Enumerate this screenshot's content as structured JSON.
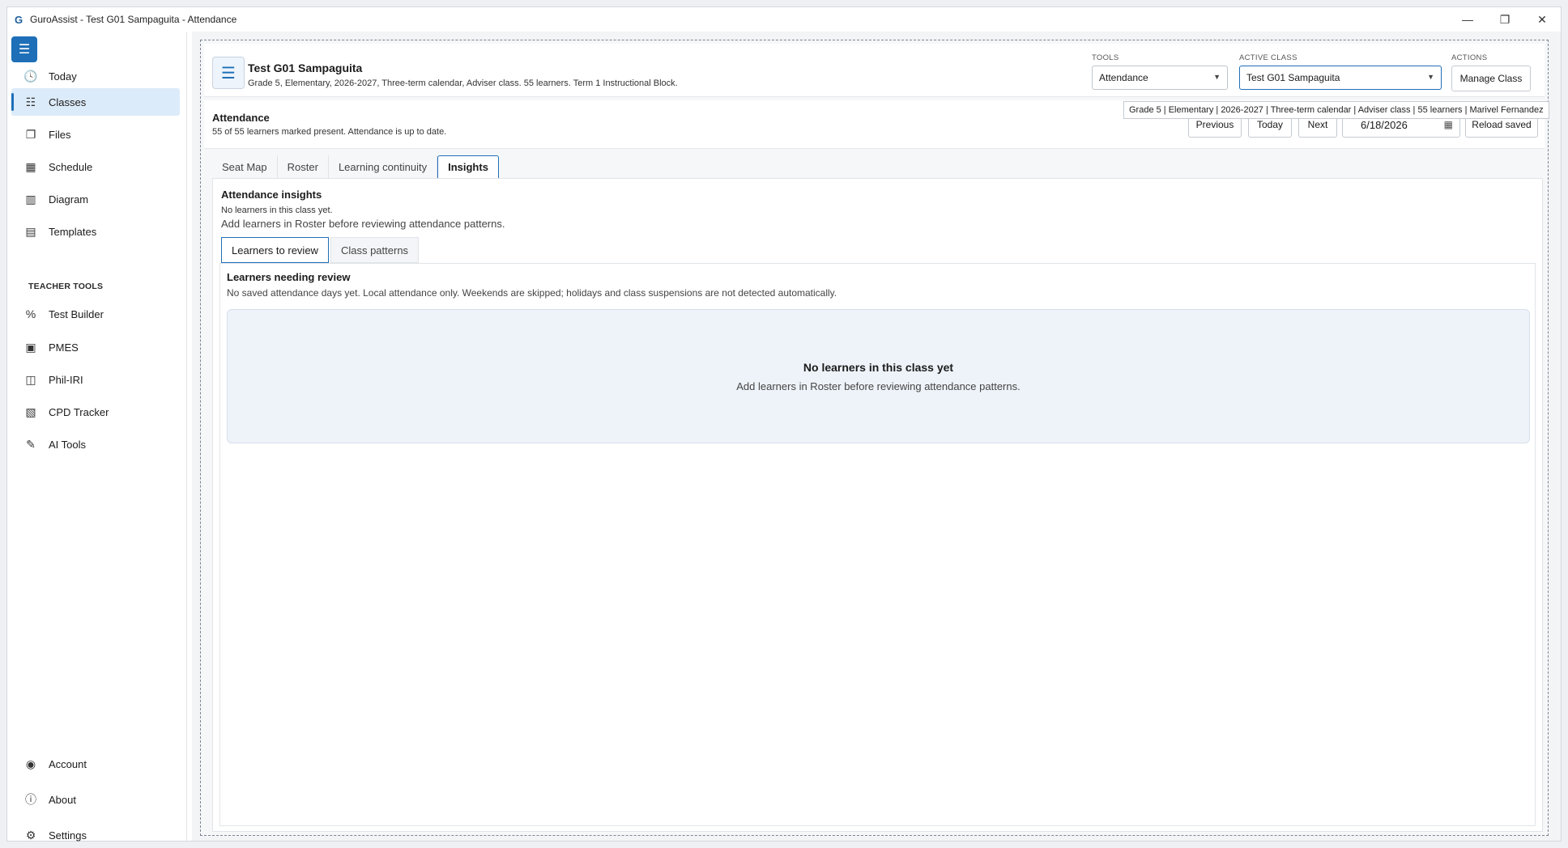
{
  "window": {
    "title": "GuroAssist - Test G01 Sampaguita - Attendance",
    "app_icon": "G",
    "controls": {
      "minimize": "—",
      "restore": "❐",
      "close": "✕"
    }
  },
  "sidebar": {
    "menu_icon": "☰",
    "items": [
      {
        "label": "Today",
        "icon": "🕓"
      },
      {
        "label": "Classes",
        "icon": "☷"
      },
      {
        "label": "Files",
        "icon": "❐"
      },
      {
        "label": "Schedule",
        "icon": "▦"
      },
      {
        "label": "Diagram",
        "icon": "▥"
      },
      {
        "label": "Templates",
        "icon": "▤"
      }
    ],
    "section_label": "TEACHER TOOLS",
    "tools": [
      {
        "label": "Test Builder",
        "icon": "%"
      },
      {
        "label": "PMES",
        "icon": "▣"
      },
      {
        "label": "Phil-IRI",
        "icon": "◫"
      },
      {
        "label": "CPD Tracker",
        "icon": "▧"
      },
      {
        "label": "AI Tools",
        "icon": "✎"
      }
    ],
    "bottom": [
      {
        "label": "Account",
        "icon": "◉"
      },
      {
        "label": "About",
        "icon": "ⓘ"
      },
      {
        "label": "Settings",
        "icon": "⚙"
      }
    ]
  },
  "header": {
    "icon": "☰",
    "class_title": "Test G01 Sampaguita",
    "class_sub": "Grade 5, Elementary, 2026-2027, Three-term calendar, Adviser class. 55 learners. Term 1 Instructional Block.",
    "tools_label": "TOOLS",
    "tools_value": "Attendance",
    "active_class_label": "ACTIVE CLASS",
    "active_class_value": "Test G01 Sampaguita",
    "actions_label": "ACTIONS",
    "manage_class": "Manage Class",
    "tooltip": "Grade 5 | Elementary | 2026-2027 | Three-term calendar | Adviser class | 55 learners | Marivel Fernandez"
  },
  "attendance": {
    "title": "Attendance",
    "summary": "55 of 55 learners marked present. Attendance is up to date.",
    "previous": "Previous",
    "today": "Today",
    "next": "Next",
    "date": "6/18/2026",
    "reload": "Reload saved"
  },
  "tabs": [
    "Seat Map",
    "Roster",
    "Learning continuity",
    "Insights"
  ],
  "insights": {
    "title": "Attendance insights",
    "sub1": "No learners in this class yet.",
    "sub2": "Add learners in Roster before reviewing attendance patterns.",
    "subtabs": [
      "Learners to review",
      "Class patterns"
    ],
    "panel_title": "Learners needing review",
    "panel_sub": "No saved attendance days yet. Local attendance only. Weekends are skipped; holidays and class suspensions are not detected automatically.",
    "empty_title": "No learners in this class yet",
    "empty_sub": "Add learners in Roster before reviewing attendance patterns."
  },
  "colors": {
    "accent": "#1e6fb8",
    "selected_bg": "#dcebf9",
    "empty_bg": "#eef3f9"
  }
}
